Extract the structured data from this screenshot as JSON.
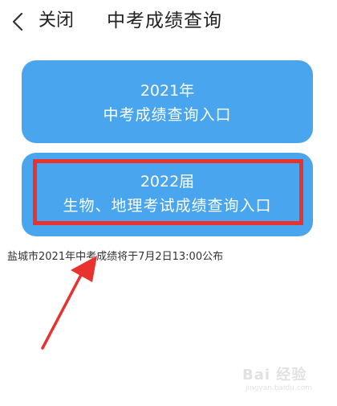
{
  "header": {
    "back_icon": "chevron-left-icon",
    "close_label": "关闭",
    "title": "中考成绩查询"
  },
  "entries": [
    {
      "line1": "2021年",
      "line2": "中考成绩查询入口",
      "highlighted": false
    },
    {
      "line1": "2022届",
      "line2": "生物、地理考试成绩查询入口",
      "highlighted": true
    }
  ],
  "notice": "盐城市2021年中考成绩将于7月2日13:00公布",
  "colors": {
    "button_blue": "#4aa5ef",
    "highlight_red": "#e8322e",
    "arrow_red": "#e8322e"
  },
  "annotation": {
    "arrow_icon": "red-arrow-icon"
  },
  "watermark": {
    "text": "Bai 经验",
    "sub": "jingyan.baidu.com"
  }
}
